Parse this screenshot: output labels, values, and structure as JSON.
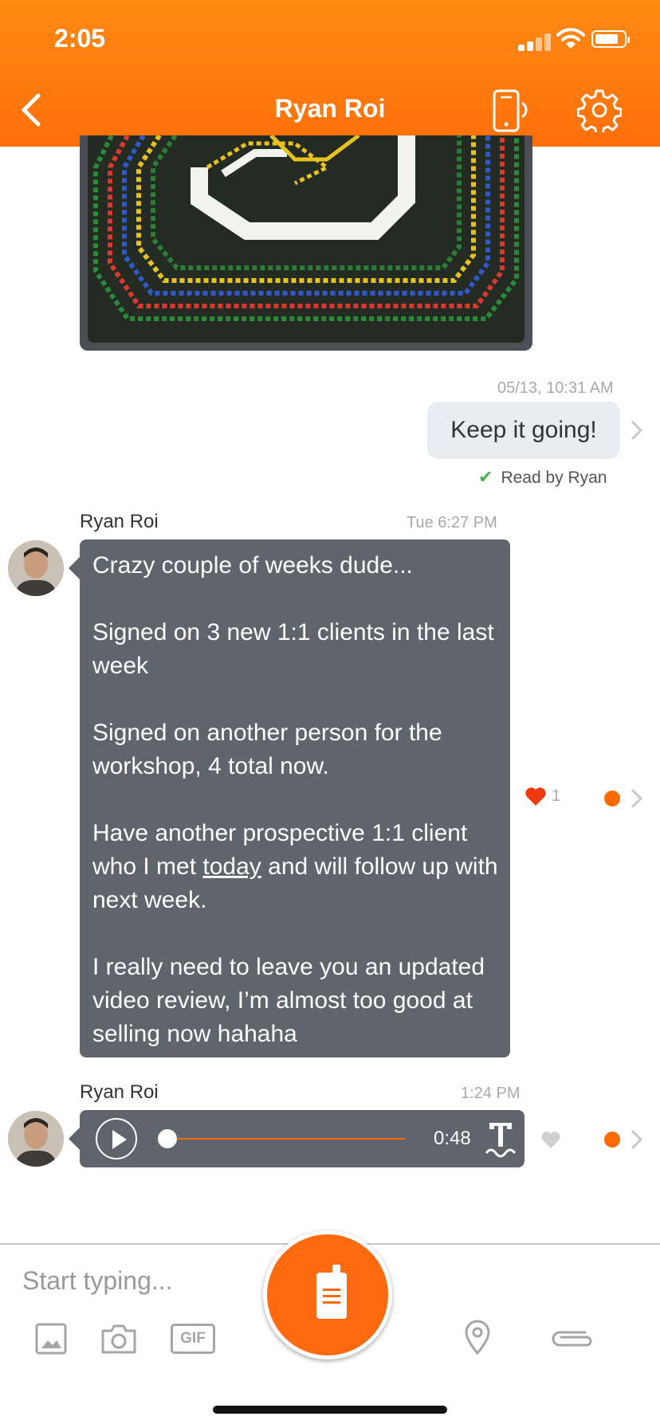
{
  "status_bar": {
    "time": "2:05"
  },
  "header": {
    "title": "Ryan Roi"
  },
  "messages": {
    "outgoing": {
      "timestamp": "05/13, 10:31 AM",
      "text": "Keep it going!",
      "read_receipt": "Read by Ryan"
    },
    "incoming_text": {
      "sender": "Ryan Roi",
      "timestamp": "Tue 6:27 PM",
      "paragraphs": [
        "Crazy couple of weeks dude...",
        "Signed on 3 new 1:1 clients in the last week",
        "Signed on another person for the workshop, 4 total now.",
        "Have another prospective 1:1 client who I met",
        "today",
        "and will follow up with next week.",
        "I really need to leave you an updated video review, I’m almost too good at selling now hahaha"
      ],
      "like_count": "1"
    },
    "incoming_audio": {
      "sender": "Ryan Roi",
      "timestamp": "1:24 PM",
      "duration": "0:48",
      "progress": 0
    }
  },
  "composer": {
    "placeholder": "Start typing...",
    "gif_label": "GIF"
  },
  "colors": {
    "accent": "#ff6a00",
    "header": "#ff7b0e",
    "bubble_incoming": "#5e656c",
    "bubble_outgoing": "#e9edf1",
    "read_check": "#4cae4c"
  }
}
